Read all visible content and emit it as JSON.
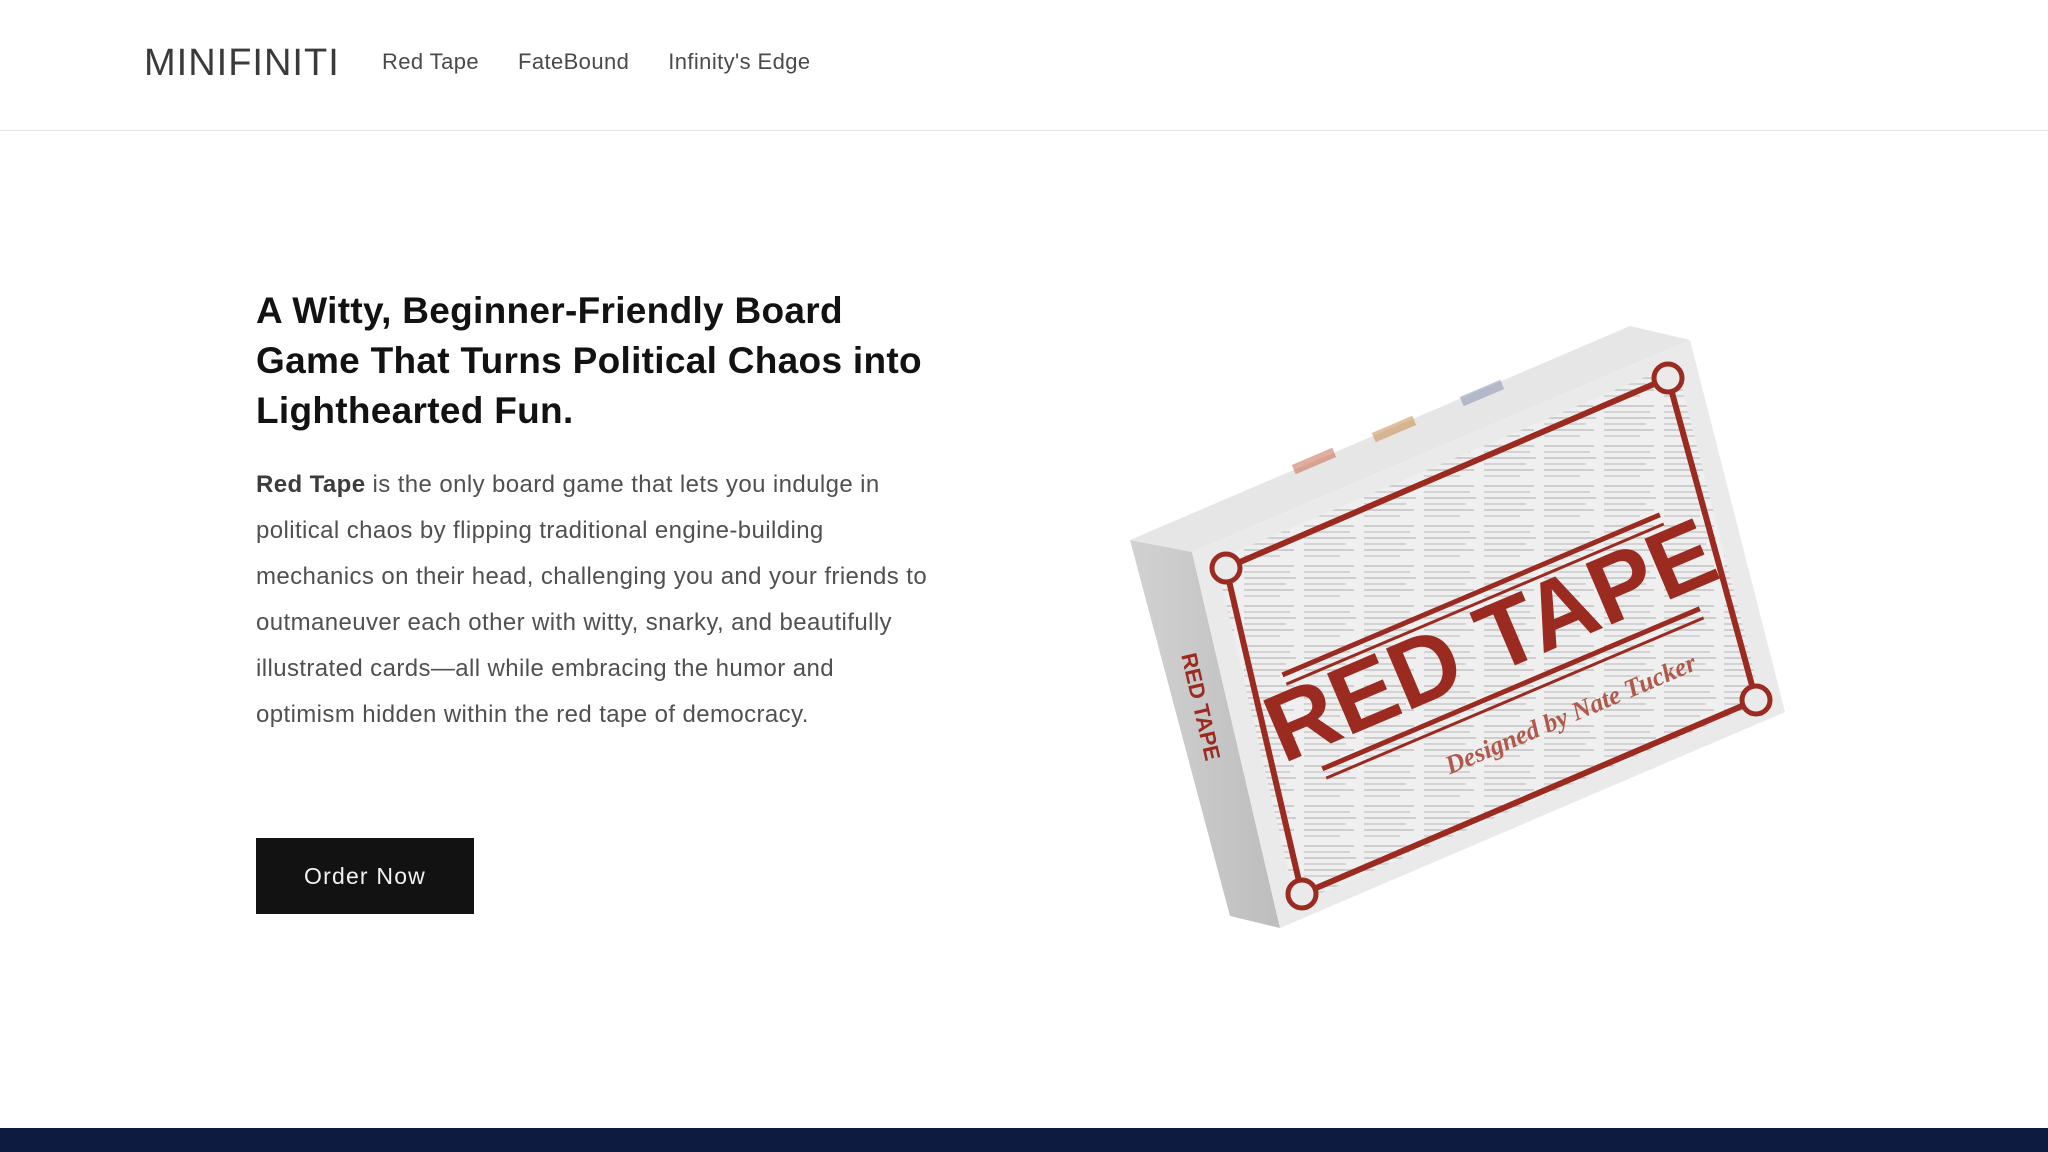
{
  "brand": {
    "name": "MINIFINITI"
  },
  "nav": {
    "items": [
      "Red Tape",
      "FateBound",
      "Infinity's Edge"
    ]
  },
  "hero": {
    "headline": "A Witty, Beginner-Friendly Board Game That Turns Political Chaos into Lighthearted Fun.",
    "description_strong": "Red Tape",
    "description_rest": " is the only board game that lets you indulge in political chaos by flipping traditional engine-building mechanics on their head, challenging you and your friends to outmaneuver each other with witty, snarky, and beautifully illustrated cards—all while embracing the humor and optimism hidden within the red tape of democracy.",
    "cta_label": "Order Now"
  },
  "product_box": {
    "title": "RED TAPE",
    "byline": "Designed by Nate Tucker",
    "spine_title": "RED TAPE"
  },
  "colors": {
    "accent_red": "#9b2a20",
    "button_bg": "#121212",
    "footer_navy": "#0c1b3f"
  }
}
